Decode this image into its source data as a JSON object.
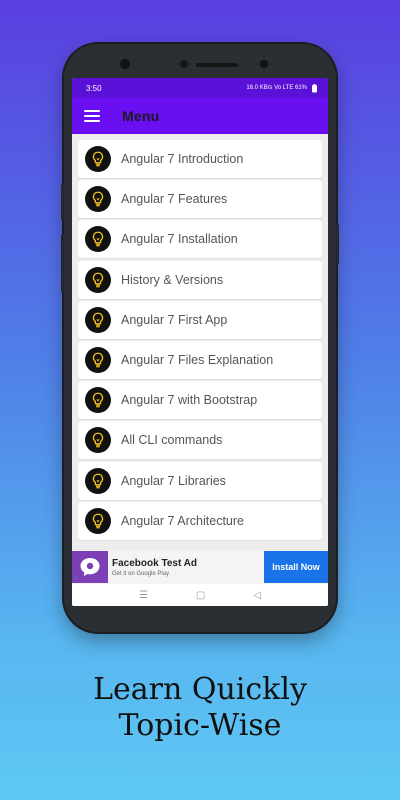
{
  "status_bar": {
    "time": "3:50",
    "right": "16.0 KB/s  Vo LTE  61%",
    "battery": "61%"
  },
  "app_bar": {
    "title": "Menu",
    "menu_icon": "hamburger-icon"
  },
  "topics": [
    {
      "label": "Angular 7 Introduction",
      "icon": "lightbulb-icon"
    },
    {
      "label": "Angular 7 Features",
      "icon": "lightbulb-icon"
    },
    {
      "label": "Angular 7 Installation",
      "icon": "lightbulb-icon"
    },
    {
      "label": "History & Versions",
      "icon": "lightbulb-icon"
    },
    {
      "label": "Angular 7 First App",
      "icon": "lightbulb-icon"
    },
    {
      "label": "Angular 7 Files Explanation",
      "icon": "lightbulb-icon"
    },
    {
      "label": "Angular 7 with Bootstrap",
      "icon": "lightbulb-icon"
    },
    {
      "label": "All CLI commands",
      "icon": "lightbulb-icon"
    },
    {
      "label": "Angular 7 Libraries",
      "icon": "lightbulb-icon"
    },
    {
      "label": "Angular 7 Architecture",
      "icon": "lightbulb-icon"
    }
  ],
  "ad": {
    "title": "Facebook Test Ad",
    "subtitle": "Get it on Google Play",
    "install_label": "Install Now"
  },
  "nav_bar": {
    "recents": "☰",
    "home": "▢",
    "back": "◁"
  },
  "tagline": {
    "line1": "Learn Quickly",
    "line2": "Topic-Wise"
  },
  "colors": {
    "status_bar": "#5b10d8",
    "app_bar": "#6a0ff2",
    "bulb_yellow": "#f2c21b",
    "install_button": "#1a73e8"
  }
}
